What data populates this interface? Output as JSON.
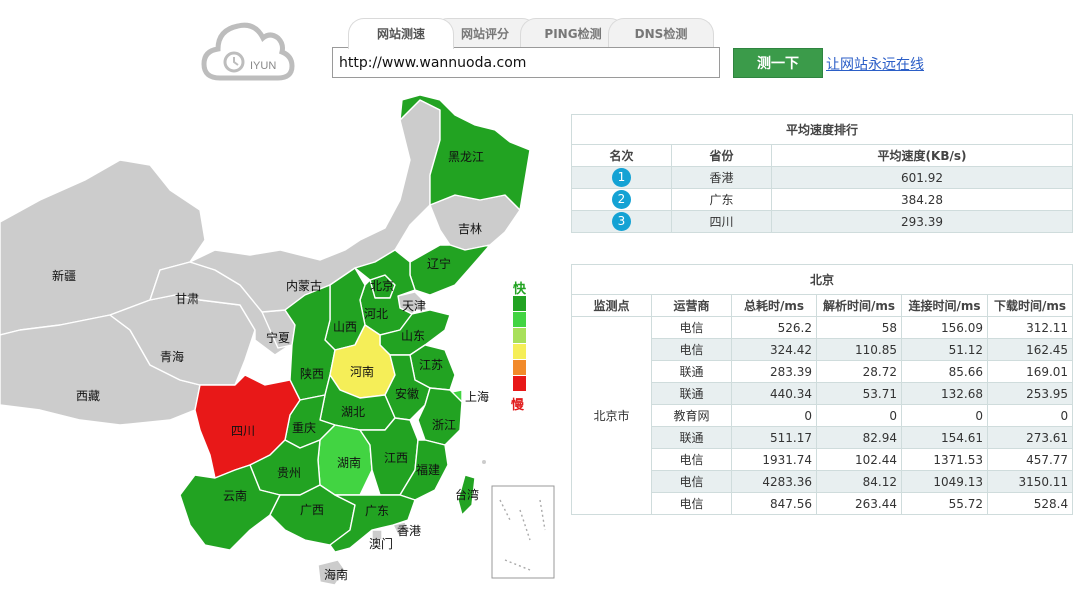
{
  "logo": {
    "text": "IYUN"
  },
  "tabs": [
    {
      "label": "网站测速",
      "active": true
    },
    {
      "label": "网站评分",
      "active": false
    },
    {
      "label": "PING检测",
      "active": false
    },
    {
      "label": "DNS检测",
      "active": false
    }
  ],
  "search": {
    "value": "http://www.wannuoda.com",
    "button_label": "测一下",
    "link_label": "让网站永远在线"
  },
  "colors": {
    "fast": "#22a322",
    "green2": "#42d442",
    "yellow": "#f5ee58",
    "orange": "#f28a2a",
    "red": "#e81818",
    "grey": "#cccccc",
    "accent": "#3b9b4a",
    "badge": "#14a2d4"
  },
  "map": {
    "legend": {
      "fast": "快",
      "slow": "慢"
    },
    "provinces": [
      {
        "name": "黑龙江",
        "level": "fast"
      },
      {
        "name": "吉林",
        "level": "none"
      },
      {
        "name": "辽宁",
        "level": "fast"
      },
      {
        "name": "内蒙古",
        "level": "none"
      },
      {
        "name": "新疆",
        "level": "none"
      },
      {
        "name": "甘肃",
        "level": "none"
      },
      {
        "name": "青海",
        "level": "none"
      },
      {
        "name": "西藏",
        "level": "none"
      },
      {
        "name": "宁夏",
        "level": "none"
      },
      {
        "name": "北京",
        "level": "fast"
      },
      {
        "name": "天津",
        "level": "none"
      },
      {
        "name": "河北",
        "level": "fast"
      },
      {
        "name": "山西",
        "level": "fast"
      },
      {
        "name": "山东",
        "level": "fast"
      },
      {
        "name": "陕西",
        "level": "fast"
      },
      {
        "name": "河南",
        "level": "yellow"
      },
      {
        "name": "江苏",
        "level": "fast"
      },
      {
        "name": "安徽",
        "level": "fast"
      },
      {
        "name": "上海",
        "level": "green2"
      },
      {
        "name": "四川",
        "level": "red"
      },
      {
        "name": "重庆",
        "level": "fast"
      },
      {
        "name": "湖北",
        "level": "fast"
      },
      {
        "name": "浙江",
        "level": "fast"
      },
      {
        "name": "湖南",
        "level": "green2"
      },
      {
        "name": "江西",
        "level": "fast"
      },
      {
        "name": "贵州",
        "level": "fast"
      },
      {
        "name": "福建",
        "level": "fast"
      },
      {
        "name": "云南",
        "level": "fast"
      },
      {
        "name": "台湾",
        "level": "fast"
      },
      {
        "name": "广西",
        "level": "fast"
      },
      {
        "name": "广东",
        "level": "fast"
      },
      {
        "name": "香港",
        "level": "none"
      },
      {
        "name": "澳门",
        "level": "none"
      },
      {
        "name": "海南",
        "level": "none"
      }
    ]
  },
  "ranking": {
    "title": "平均速度排行",
    "headers": [
      "名次",
      "省份",
      "平均速度(KB/s)"
    ],
    "rows": [
      {
        "rank": "1",
        "province": "香港",
        "speed": "601.92"
      },
      {
        "rank": "2",
        "province": "广东",
        "speed": "384.28"
      },
      {
        "rank": "3",
        "province": "四川",
        "speed": "293.39"
      }
    ]
  },
  "detail": {
    "title": "北京",
    "headers": [
      "监测点",
      "运营商",
      "总耗时/ms",
      "解析时间/ms",
      "连接时间/ms",
      "下载时间/ms"
    ],
    "station": "北京市",
    "rows": [
      {
        "isp": "电信",
        "total": "526.2",
        "dns": "58",
        "connect": "156.09",
        "download": "312.11"
      },
      {
        "isp": "电信",
        "total": "324.42",
        "dns": "110.85",
        "connect": "51.12",
        "download": "162.45"
      },
      {
        "isp": "联通",
        "total": "283.39",
        "dns": "28.72",
        "connect": "85.66",
        "download": "169.01"
      },
      {
        "isp": "联通",
        "total": "440.34",
        "dns": "53.71",
        "connect": "132.68",
        "download": "253.95"
      },
      {
        "isp": "教育网",
        "total": "0",
        "dns": "0",
        "connect": "0",
        "download": "0"
      },
      {
        "isp": "联通",
        "total": "511.17",
        "dns": "82.94",
        "connect": "154.61",
        "download": "273.61"
      },
      {
        "isp": "电信",
        "total": "1931.74",
        "dns": "102.44",
        "connect": "1371.53",
        "download": "457.77"
      },
      {
        "isp": "电信",
        "total": "4283.36",
        "dns": "84.12",
        "connect": "1049.13",
        "download": "3150.11"
      },
      {
        "isp": "电信",
        "total": "847.56",
        "dns": "263.44",
        "connect": "55.72",
        "download": "528.4"
      }
    ]
  }
}
